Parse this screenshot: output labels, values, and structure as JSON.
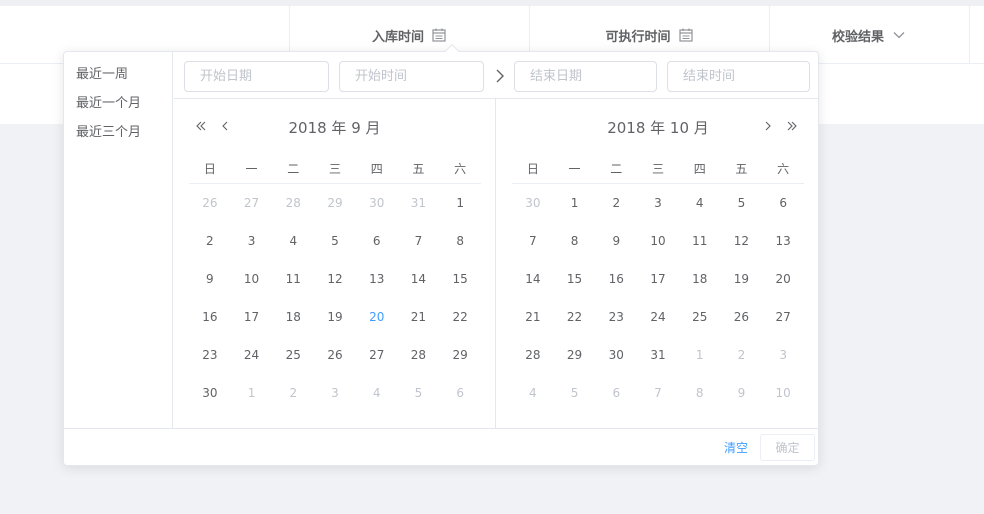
{
  "table": {
    "columns": [
      {
        "label": "入库时间",
        "icon": "calendar-icon"
      },
      {
        "label": "可执行时间",
        "icon": "calendar-icon"
      },
      {
        "label": "校验结果",
        "icon": "chevron-down-icon"
      }
    ]
  },
  "picker": {
    "shortcuts": [
      "最近一周",
      "最近一个月",
      "最近三个月"
    ],
    "start_date_placeholder": "开始日期",
    "start_time_placeholder": "开始时间",
    "end_date_placeholder": "结束日期",
    "end_time_placeholder": "结束时间",
    "weekdays": [
      "日",
      "一",
      "二",
      "三",
      "四",
      "五",
      "六"
    ],
    "left_month": "2018 年 9 月",
    "right_month": "2018 年 10 月",
    "left_days": [
      {
        "d": "26",
        "s": "other"
      },
      {
        "d": "27",
        "s": "other"
      },
      {
        "d": "28",
        "s": "other"
      },
      {
        "d": "29",
        "s": "other"
      },
      {
        "d": "30",
        "s": "other"
      },
      {
        "d": "31",
        "s": "other"
      },
      {
        "d": "1",
        "s": ""
      },
      {
        "d": "2",
        "s": ""
      },
      {
        "d": "3",
        "s": ""
      },
      {
        "d": "4",
        "s": ""
      },
      {
        "d": "5",
        "s": ""
      },
      {
        "d": "6",
        "s": ""
      },
      {
        "d": "7",
        "s": ""
      },
      {
        "d": "8",
        "s": ""
      },
      {
        "d": "9",
        "s": ""
      },
      {
        "d": "10",
        "s": ""
      },
      {
        "d": "11",
        "s": ""
      },
      {
        "d": "12",
        "s": ""
      },
      {
        "d": "13",
        "s": ""
      },
      {
        "d": "14",
        "s": ""
      },
      {
        "d": "15",
        "s": ""
      },
      {
        "d": "16",
        "s": ""
      },
      {
        "d": "17",
        "s": ""
      },
      {
        "d": "18",
        "s": ""
      },
      {
        "d": "19",
        "s": ""
      },
      {
        "d": "20",
        "s": "today"
      },
      {
        "d": "21",
        "s": ""
      },
      {
        "d": "22",
        "s": ""
      },
      {
        "d": "23",
        "s": ""
      },
      {
        "d": "24",
        "s": ""
      },
      {
        "d": "25",
        "s": ""
      },
      {
        "d": "26",
        "s": ""
      },
      {
        "d": "27",
        "s": ""
      },
      {
        "d": "28",
        "s": ""
      },
      {
        "d": "29",
        "s": ""
      },
      {
        "d": "30",
        "s": ""
      },
      {
        "d": "1",
        "s": "other"
      },
      {
        "d": "2",
        "s": "other"
      },
      {
        "d": "3",
        "s": "other"
      },
      {
        "d": "4",
        "s": "other"
      },
      {
        "d": "5",
        "s": "other"
      },
      {
        "d": "6",
        "s": "other"
      }
    ],
    "right_days": [
      {
        "d": "30",
        "s": "other"
      },
      {
        "d": "1",
        "s": ""
      },
      {
        "d": "2",
        "s": ""
      },
      {
        "d": "3",
        "s": ""
      },
      {
        "d": "4",
        "s": ""
      },
      {
        "d": "5",
        "s": ""
      },
      {
        "d": "6",
        "s": ""
      },
      {
        "d": "7",
        "s": ""
      },
      {
        "d": "8",
        "s": ""
      },
      {
        "d": "9",
        "s": ""
      },
      {
        "d": "10",
        "s": ""
      },
      {
        "d": "11",
        "s": ""
      },
      {
        "d": "12",
        "s": ""
      },
      {
        "d": "13",
        "s": ""
      },
      {
        "d": "14",
        "s": ""
      },
      {
        "d": "15",
        "s": ""
      },
      {
        "d": "16",
        "s": ""
      },
      {
        "d": "17",
        "s": ""
      },
      {
        "d": "18",
        "s": ""
      },
      {
        "d": "19",
        "s": ""
      },
      {
        "d": "20",
        "s": ""
      },
      {
        "d": "21",
        "s": ""
      },
      {
        "d": "22",
        "s": ""
      },
      {
        "d": "23",
        "s": ""
      },
      {
        "d": "24",
        "s": ""
      },
      {
        "d": "25",
        "s": ""
      },
      {
        "d": "26",
        "s": ""
      },
      {
        "d": "27",
        "s": ""
      },
      {
        "d": "28",
        "s": ""
      },
      {
        "d": "29",
        "s": ""
      },
      {
        "d": "30",
        "s": ""
      },
      {
        "d": "31",
        "s": ""
      },
      {
        "d": "1",
        "s": "other"
      },
      {
        "d": "2",
        "s": "other"
      },
      {
        "d": "3",
        "s": "other"
      },
      {
        "d": "4",
        "s": "other"
      },
      {
        "d": "5",
        "s": "other"
      },
      {
        "d": "6",
        "s": "other"
      },
      {
        "d": "7",
        "s": "other"
      },
      {
        "d": "8",
        "s": "other"
      },
      {
        "d": "9",
        "s": "other"
      },
      {
        "d": "10",
        "s": "other"
      }
    ],
    "clear_label": "清空",
    "confirm_label": "确定"
  },
  "colors": {
    "accent": "#409eff",
    "text": "#606266",
    "muted": "#c0c4cc",
    "border": "#e4e7ed",
    "page_bg": "#f0f2f5"
  }
}
